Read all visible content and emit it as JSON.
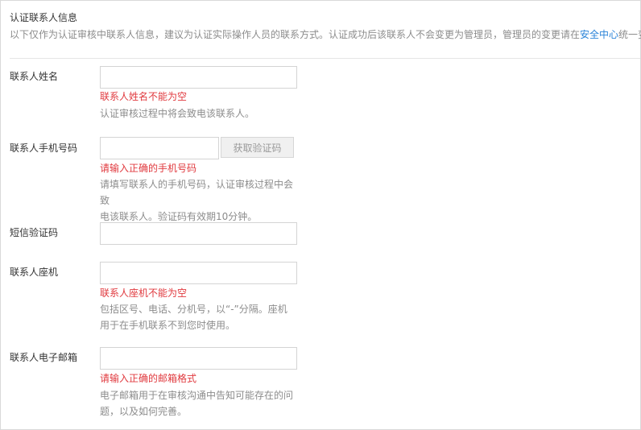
{
  "section": {
    "title": "认证联系人信息",
    "notice_before_link": "以下仅作为认证审核中联系人信息，建议为认证实际操作人员的联系方式。认证成功后该联系人不会变更为管理员，管理员的变更请在",
    "notice_link": "安全中心",
    "notice_after_link": "统一变更。"
  },
  "fields": {
    "name": {
      "label": "联系人姓名",
      "value": "",
      "error": "联系人姓名不能为空",
      "help_lines": [
        "认证审核过程中将会致电该联系人。"
      ]
    },
    "mobile": {
      "label": "联系人手机号码",
      "value": "",
      "button": "获取验证码",
      "error": "请输入正确的手机号码",
      "help_lines": [
        "请填写联系人的手机号码，认证审核过程中会致",
        "电该联系人。验证码有效期10分钟。"
      ]
    },
    "sms_code": {
      "label": "短信验证码",
      "value": ""
    },
    "landline": {
      "label": "联系人座机",
      "value": "",
      "error": "联系人座机不能为空",
      "help_lines": [
        "包括区号、电话、分机号，以“-”分隔。座机",
        "用于在手机联系不到您时使用。"
      ]
    },
    "email": {
      "label": "联系人电子邮箱",
      "value": "",
      "error": "请输入正确的邮箱格式",
      "help_lines": [
        "电子邮箱用于在审核沟通中告知可能存在的问",
        "题，以及如何完善。"
      ]
    }
  },
  "colors": {
    "error": "#e0393e",
    "link": "#2a83d8",
    "muted": "#8c8c8c"
  }
}
